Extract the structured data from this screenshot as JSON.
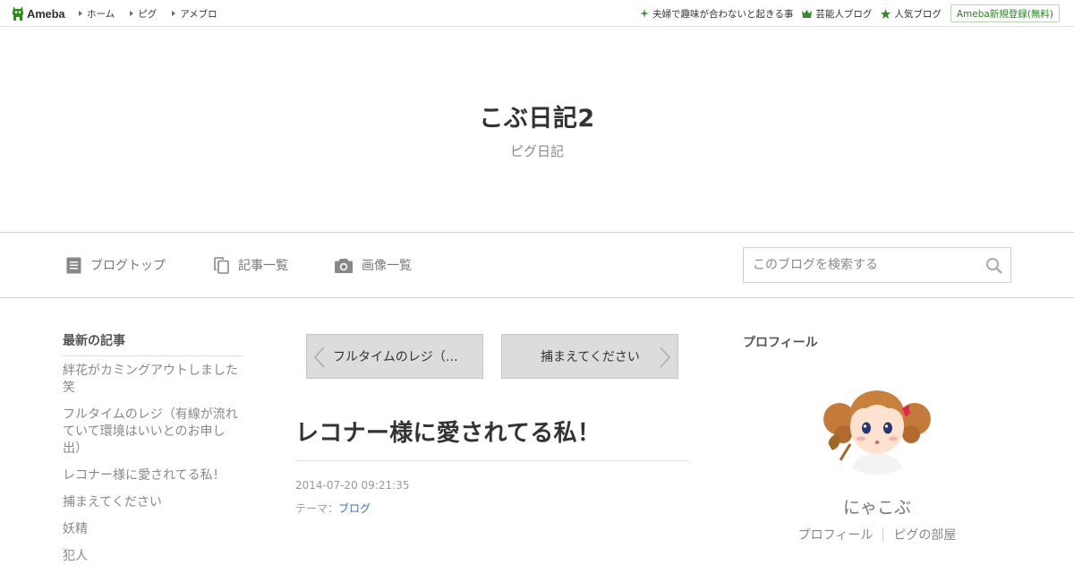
{
  "topbar": {
    "logo_text": "Ameba",
    "nav": [
      "ホーム",
      "ピグ",
      "アメブロ"
    ],
    "right_links": [
      {
        "label": "夫婦で趣味が合わないと起きる事",
        "icon": "sparkle-icon"
      },
      {
        "label": "芸能人ブログ",
        "icon": "crown-icon"
      },
      {
        "label": "人気ブログ",
        "icon": "star-icon"
      }
    ],
    "register_label": "Ameba新規登録(無料)"
  },
  "header": {
    "title": "こぶ日記2",
    "description": "ピグ日記"
  },
  "nav": {
    "items": [
      {
        "label": "ブログトップ",
        "icon": "document-icon"
      },
      {
        "label": "記事一覧",
        "icon": "copy-icon"
      },
      {
        "label": "画像一覧",
        "icon": "camera-icon"
      }
    ],
    "search_placeholder": "このブログを検索する"
  },
  "sidebar": {
    "title": "最新の記事",
    "items": [
      "絆花がカミングアウトしました笑",
      "フルタイムのレジ（有線が流れていて環境はいいとのお申し出）",
      "レコナー様に愛されてる私！",
      "捕まえてください",
      "妖精",
      "犯人"
    ]
  },
  "pager": {
    "prev_label": "フルタイムのレジ（…",
    "next_label": "捕まえてください"
  },
  "entry": {
    "title": "レコナー様に愛されてる私！",
    "date": "2014-07-20 09:21:35",
    "theme_label": "テーマ：",
    "theme_value": "ブログ"
  },
  "profile": {
    "title": "プロフィール",
    "nickname": "にゃこぶ",
    "links": [
      "プロフィール",
      "ピグの部屋"
    ]
  },
  "colors": {
    "ameba_green": "#2d7f24",
    "link_blue": "#3b6fb6",
    "pager_bg": "#dcdcdc"
  }
}
